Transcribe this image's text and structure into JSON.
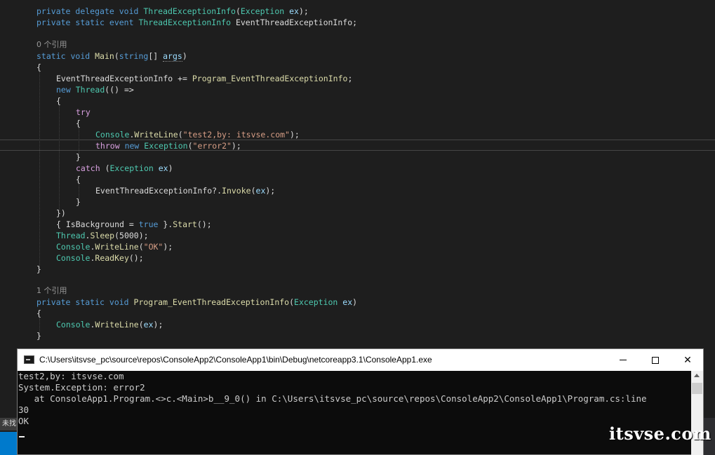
{
  "editor": {
    "code": {
      "l1": {
        "a": "private",
        "b": "delegate",
        "c": "void",
        "d": "ThreadExceptionInfo",
        "e": "(",
        "f": "Exception",
        "g": "ex",
        "h": ");"
      },
      "l2": {
        "a": "private",
        "b": "static",
        "c": "event",
        "d": "ThreadExceptionInfo",
        "e": "EventThreadExceptionInfo",
        "f": ";"
      },
      "lens1": "0 个引用",
      "l3": {
        "a": "static",
        "b": "void",
        "c": "Main",
        "d": "(",
        "e": "string",
        "f": "[]",
        "g": "args",
        "h": ")"
      },
      "l4": "{",
      "l5": {
        "a": "EventThreadExceptionInfo",
        "b": " += ",
        "c": "Program_EventThreadExceptionInfo",
        "d": ";"
      },
      "l6": {
        "a": "new",
        "b": "Thread",
        "c": "(() =>"
      },
      "l7": "{",
      "l8": "try",
      "l9": "{",
      "l10": {
        "a": "Console",
        "b": ".",
        "c": "WriteLine",
        "d": "(",
        "e": "\"test2,by: itsvse.com\"",
        "f": ");"
      },
      "l11": {
        "a": "throw",
        "b": "new",
        "c": "Exception",
        "d": "(",
        "e": "\"error2\"",
        "f": ");"
      },
      "l12": "}",
      "l13": {
        "a": "catch",
        "b": "(",
        "c": "Exception",
        "d": "ex",
        "e": ")"
      },
      "l14": "{",
      "l15": {
        "a": "EventThreadExceptionInfo",
        "b": "?.",
        "c": "Invoke",
        "d": "(",
        "e": "ex",
        "f": ");"
      },
      "l16": "}",
      "l17": "})",
      "l18": {
        "a": "{ ",
        "b": "IsBackground",
        "c": " = ",
        "d": "true",
        "e": " }.",
        "f": "Start",
        "g": "();"
      },
      "l19": {
        "a": "Thread",
        "b": ".",
        "c": "Sleep",
        "d": "(5000);"
      },
      "l20": {
        "a": "Console",
        "b": ".",
        "c": "WriteLine",
        "d": "(",
        "e": "\"OK\"",
        "f": ");"
      },
      "l21": {
        "a": "Console",
        "b": ".",
        "c": "ReadKey",
        "d": "();"
      },
      "l22": "}",
      "lens2": "1 个引用",
      "l23": {
        "a": "private",
        "b": "static",
        "c": "void",
        "d": "Program_EventThreadExceptionInfo",
        "e": "(",
        "f": "Exception",
        "g": "ex",
        "h": ")"
      },
      "l24": "{",
      "l25": {
        "a": "Console",
        "b": ".",
        "c": "WriteLine",
        "d": "(",
        "e": "ex",
        "f": ");"
      },
      "l26": "}"
    },
    "side_tab_label": "未找"
  },
  "console": {
    "title": "C:\\Users\\itsvse_pc\\source\\repos\\ConsoleApp2\\ConsoleApp1\\bin\\Debug\\netcoreapp3.1\\ConsoleApp1.exe",
    "output": [
      "test2,by: itsvse.com",
      "System.Exception: error2",
      "   at ConsoleApp1.Program.<>c.<Main>b__9_0() in C:\\Users\\itsvse_pc\\source\\repos\\ConsoleApp2\\ConsoleApp1\\Program.cs:line",
      "30",
      "OK"
    ],
    "minimize_icon": "minimize-icon",
    "maximize_icon": "maximize-icon",
    "close_icon": "close-icon",
    "close_glyph": "✕"
  },
  "watermark": "itsvse.com",
  "colors": {
    "editor_bg": "#1e1e1e",
    "keyword": "#569cd6",
    "type": "#4ec9b0",
    "method": "#dcdcaa",
    "string": "#d69d85",
    "console_bg": "#0c0c0c"
  }
}
